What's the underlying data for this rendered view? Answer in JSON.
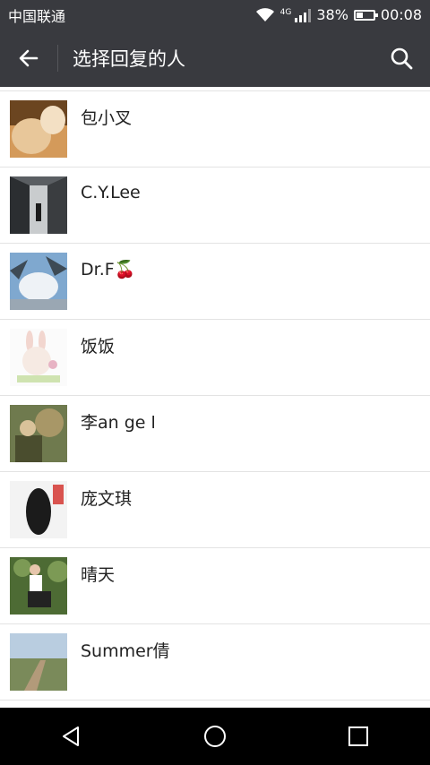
{
  "status_bar": {
    "carrier": "中国联通",
    "network": "4G",
    "battery": "38%",
    "battery_level": 0.38,
    "time": "00:08"
  },
  "toolbar": {
    "title": "选择回复的人",
    "back_icon": "arrow-left-icon",
    "search_icon": "search-icon"
  },
  "contacts": [
    {
      "name": "包小叉"
    },
    {
      "name": "C.Y.Lee"
    },
    {
      "name": "Dr.F🍒"
    },
    {
      "name": "饭饭"
    },
    {
      "name": "李an ge l"
    },
    {
      "name": "庞文琪"
    },
    {
      "name": "晴天"
    },
    {
      "name": "Summer倩"
    }
  ],
  "nav": {
    "back_icon": "triangle-back-icon",
    "home_icon": "circle-home-icon",
    "recents_icon": "square-recents-icon"
  },
  "colors": {
    "toolbar_bg": "#393a3f",
    "divider": "#e3e3e3",
    "nav_bg": "#000000"
  }
}
